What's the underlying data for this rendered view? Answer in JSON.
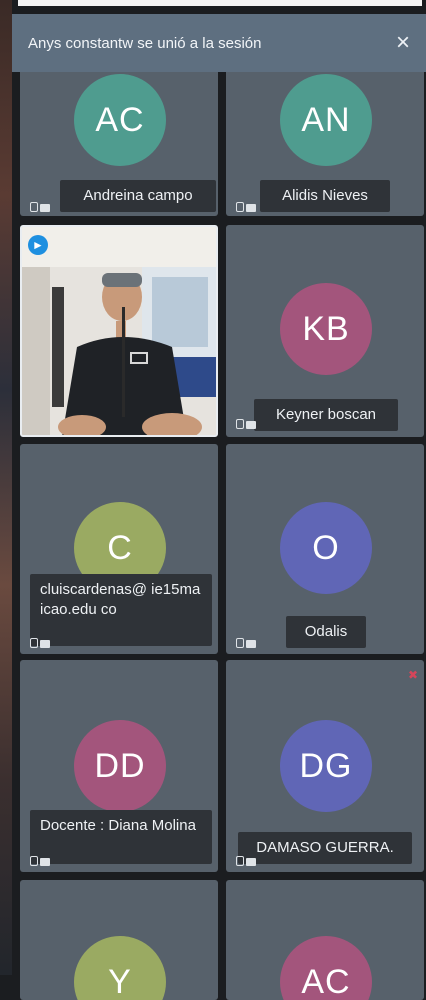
{
  "toast": {
    "message": "Anys constantw se unió a la sesión",
    "close_icon": "×"
  },
  "participants": [
    {
      "initials": "AC",
      "name": "Andreina campo",
      "color": "#4f9c8f"
    },
    {
      "initials": "AN",
      "name": "Alidis Nieves",
      "color": "#4f9c8f"
    },
    {
      "initials": "",
      "name": "",
      "video": true
    },
    {
      "initials": "KB",
      "name": "Keyner boscan",
      "color": "#a3557c"
    },
    {
      "initials": "C",
      "name": "cluiscardenas@ ie15maicao.edu co",
      "color": "#9aaa62"
    },
    {
      "initials": "O",
      "name": "Odalis",
      "color": "#6066b6"
    },
    {
      "initials": "DD",
      "name": "Docente : Diana Molina",
      "color": "#a3557c"
    },
    {
      "initials": "DG",
      "name": "DAMASO GUERRA.",
      "color": "#6066b6"
    },
    {
      "initials": "Y",
      "name": "",
      "color": "#9aaa62"
    },
    {
      "initials": "AC",
      "name": "",
      "color": "#a3557c"
    }
  ],
  "icons": {
    "speaker": "speaker-icon",
    "status": "status-icons"
  }
}
